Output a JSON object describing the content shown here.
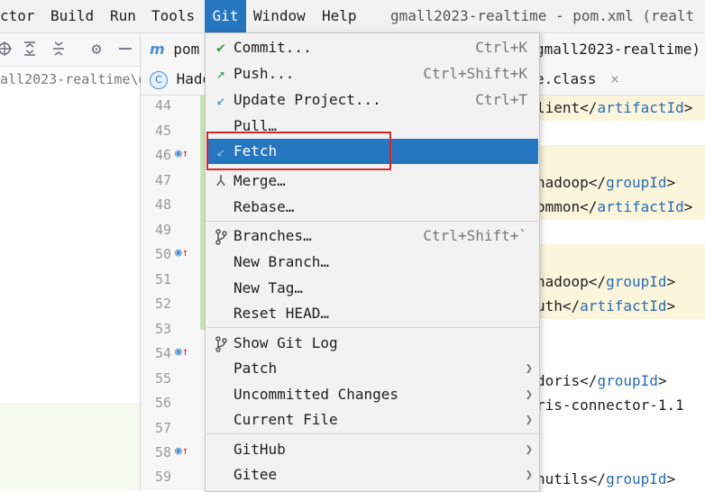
{
  "menubar": {
    "items": [
      "ctor",
      "Build",
      "Run",
      "Tools",
      "Git",
      "Window",
      "Help"
    ],
    "title": "gmall2023-realtime - pom.xml (realt"
  },
  "project": {
    "path": "all2023-realtime\\g",
    "toolbar_icons": [
      "crosshair-icon",
      "expand-all-icon",
      "collapse-all-icon",
      "gear-icon",
      "minimize-icon"
    ]
  },
  "editor": {
    "tabs": {
      "first": {
        "icon": "m",
        "label": "pom"
      },
      "second_right": "gmall2023-realtime)",
      "third": {
        "icon": "C",
        "label": "Hado"
      },
      "fourth": {
        "label": "e.class",
        "close": "×"
      }
    },
    "line_numbers": [
      "44",
      "45",
      "46",
      "47",
      "48",
      "49",
      "50",
      "51",
      "52",
      "53",
      "54",
      "55",
      "56",
      "57",
      "58",
      "59"
    ],
    "code_lines": [
      {
        "prefix": "lient</",
        "tag": "artifactId",
        "suffix": ">"
      },
      {
        "prefix": "",
        "tag": "",
        "suffix": ""
      },
      {
        "prefix": "",
        "tag": "",
        "suffix": ""
      },
      {
        "prefix": "hadoop</",
        "tag": "groupId",
        "suffix": ">"
      },
      {
        "prefix": "ommon</",
        "tag": "artifactId",
        "suffix": ">"
      },
      {
        "prefix": "",
        "tag": "",
        "suffix": ""
      },
      {
        "prefix": "",
        "tag": "",
        "suffix": ""
      },
      {
        "prefix": "hadoop</",
        "tag": "groupId",
        "suffix": ">"
      },
      {
        "prefix": "uth</",
        "tag": "artifactId",
        "suffix": ">"
      },
      {
        "prefix": "",
        "tag": "",
        "suffix": ""
      },
      {
        "prefix": "",
        "tag": "",
        "suffix": ""
      },
      {
        "prefix": "doris</",
        "tag": "groupId",
        "suffix": ">"
      },
      {
        "prefix": "ris-connector-1.1",
        "tag": "",
        "suffix": ""
      },
      {
        "prefix": "",
        "tag": "",
        "suffix": ""
      },
      {
        "prefix": "",
        "tag": "",
        "suffix": ""
      },
      {
        "prefix": "nutils</",
        "tag": "groupId",
        "suffix": ">"
      }
    ]
  },
  "git_menu": {
    "items": [
      {
        "label": "Commit...",
        "shortcut": "Ctrl+K",
        "icon": "check-icon"
      },
      {
        "label": "Push...",
        "shortcut": "Ctrl+Shift+K",
        "icon": "push-arrow-icon"
      },
      {
        "label": "Update Project...",
        "shortcut": "Ctrl+T",
        "icon": "update-arrow-icon"
      },
      {
        "label": "Pull…",
        "shortcut": "",
        "icon": ""
      },
      {
        "label": "Fetch",
        "shortcut": "",
        "icon": "fetch-arrow-icon",
        "selected": true
      },
      {
        "label": "Merge…",
        "shortcut": "",
        "icon": "merge-icon"
      },
      {
        "label": "Rebase…",
        "shortcut": "",
        "icon": ""
      },
      {
        "label": "Branches…",
        "shortcut": "Ctrl+Shift+`",
        "icon": "branch-icon"
      },
      {
        "label": "New Branch…",
        "shortcut": "",
        "icon": ""
      },
      {
        "label": "New Tag…",
        "shortcut": "",
        "icon": ""
      },
      {
        "label": "Reset HEAD…",
        "shortcut": "",
        "icon": ""
      },
      {
        "label": "Show Git Log",
        "shortcut": "",
        "icon": "git-log-icon"
      },
      {
        "label": "Patch",
        "shortcut": "",
        "icon": "",
        "submenu": true
      },
      {
        "label": "Uncommitted Changes",
        "shortcut": "",
        "icon": "",
        "submenu": true
      },
      {
        "label": "Current File",
        "shortcut": "",
        "icon": "",
        "submenu": true
      },
      {
        "label": "GitHub",
        "shortcut": "",
        "icon": "",
        "submenu": true
      },
      {
        "label": "Gitee",
        "shortcut": "",
        "icon": "",
        "submenu": true
      }
    ],
    "selection_color": "#2675bf",
    "highlight_box_color": "#d9262b"
  }
}
